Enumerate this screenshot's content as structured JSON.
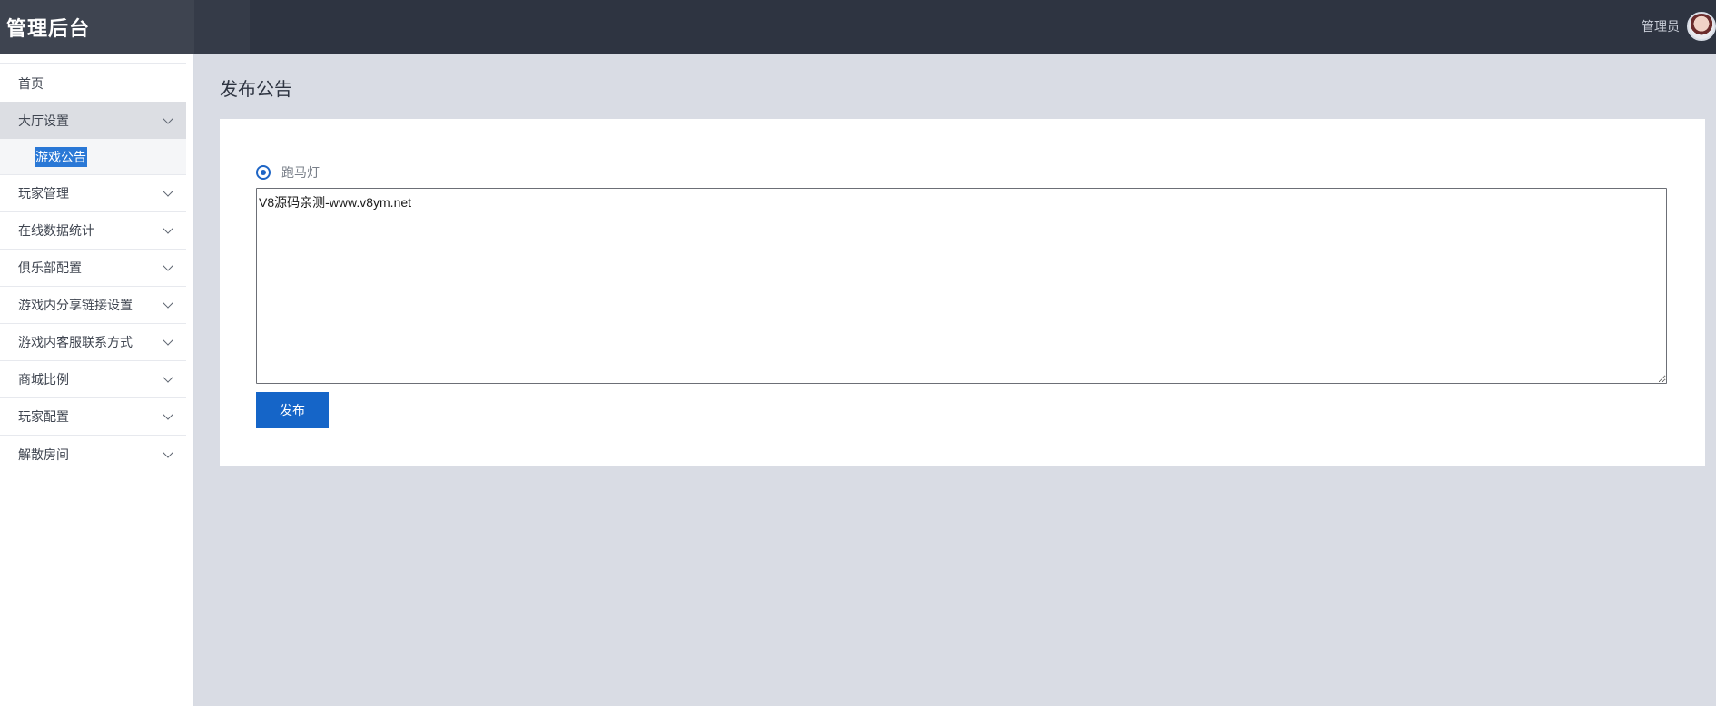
{
  "header": {
    "title": "管理后台",
    "user_name": "管理员"
  },
  "sidebar": {
    "items": [
      {
        "label": "首页",
        "has_chevron": false
      },
      {
        "label": "大厅设置",
        "has_chevron": true,
        "expanded": true,
        "children": [
          {
            "label": "游戏公告",
            "selected": true
          }
        ]
      },
      {
        "label": "玩家管理",
        "has_chevron": true
      },
      {
        "label": "在线数据统计",
        "has_chevron": true
      },
      {
        "label": "俱乐部配置",
        "has_chevron": true
      },
      {
        "label": "游戏内分享链接设置",
        "has_chevron": true
      },
      {
        "label": "游戏内客服联系方式",
        "has_chevron": true
      },
      {
        "label": "商城比例",
        "has_chevron": true
      },
      {
        "label": "玩家配置",
        "has_chevron": true
      },
      {
        "label": "解散房间",
        "has_chevron": true
      }
    ]
  },
  "main": {
    "page_title": "发布公告",
    "radio": {
      "label": "跑马灯",
      "checked": true
    },
    "textarea_value": "V8源码亲测-www.v8ym.net",
    "publish_label": "发布"
  },
  "colors": {
    "header_bg": "#2e3441",
    "brand_bg": "#3e4450",
    "accent": "#1565c8",
    "page_bg": "#d9dce4"
  }
}
